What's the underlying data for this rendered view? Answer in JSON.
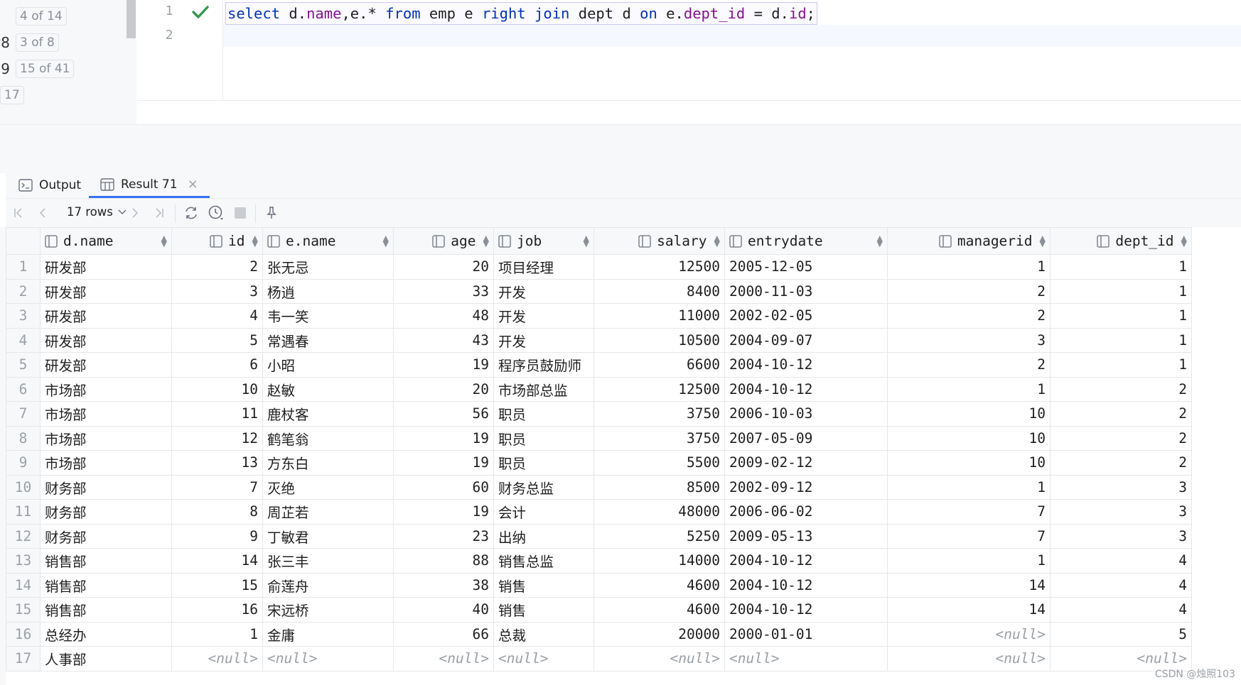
{
  "navigator": {
    "rows": [
      {
        "prefix": "",
        "badge": "4 of 14"
      },
      {
        "prefix": "8",
        "badge": "3 of 8"
      },
      {
        "prefix": "9",
        "badge": "15 of 41"
      },
      {
        "prefix": "",
        "badge": "17"
      }
    ]
  },
  "editor": {
    "line_numbers": [
      "1",
      "2"
    ],
    "tokens": [
      {
        "t": "select",
        "c": "kw"
      },
      {
        "t": " d.",
        "c": "plain"
      },
      {
        "t": "name",
        "c": "fld"
      },
      {
        "t": ",e.* ",
        "c": "plain"
      },
      {
        "t": "from",
        "c": "kw"
      },
      {
        "t": " emp e ",
        "c": "plain"
      },
      {
        "t": "right join",
        "c": "kw"
      },
      {
        "t": " dept d ",
        "c": "plain"
      },
      {
        "t": "on",
        "c": "kw"
      },
      {
        "t": " e.",
        "c": "plain"
      },
      {
        "t": "dept_id",
        "c": "fld"
      },
      {
        "t": " = d.",
        "c": "plain"
      },
      {
        "t": "id",
        "c": "fld"
      },
      {
        "t": ";",
        "c": "plain"
      }
    ]
  },
  "tabs": {
    "output": "Output",
    "result": "Result 71"
  },
  "toolbar": {
    "rows_label": "17 rows"
  },
  "grid": {
    "columns": [
      {
        "name": "d.name",
        "align": "left"
      },
      {
        "name": "id",
        "align": "right"
      },
      {
        "name": "e.name",
        "align": "left"
      },
      {
        "name": "age",
        "align": "right"
      },
      {
        "name": "job",
        "align": "left"
      },
      {
        "name": "salary",
        "align": "right"
      },
      {
        "name": "entrydate",
        "align": "left"
      },
      {
        "name": "managerid",
        "align": "right"
      },
      {
        "name": "dept_id",
        "align": "right"
      }
    ],
    "null_text": "<null>",
    "rows": [
      [
        "研发部",
        "2",
        "张无忌",
        "20",
        "项目经理",
        "12500",
        "2005-12-05",
        "1",
        "1"
      ],
      [
        "研发部",
        "3",
        "杨逍",
        "33",
        "开发",
        "8400",
        "2000-11-03",
        "2",
        "1"
      ],
      [
        "研发部",
        "4",
        "韦一笑",
        "48",
        "开发",
        "11000",
        "2002-02-05",
        "2",
        "1"
      ],
      [
        "研发部",
        "5",
        "常遇春",
        "43",
        "开发",
        "10500",
        "2004-09-07",
        "3",
        "1"
      ],
      [
        "研发部",
        "6",
        "小昭",
        "19",
        "程序员鼓励师",
        "6600",
        "2004-10-12",
        "2",
        "1"
      ],
      [
        "市场部",
        "10",
        "赵敏",
        "20",
        "市场部总监",
        "12500",
        "2004-10-12",
        "1",
        "2"
      ],
      [
        "市场部",
        "11",
        "鹿杖客",
        "56",
        "职员",
        "3750",
        "2006-10-03",
        "10",
        "2"
      ],
      [
        "市场部",
        "12",
        "鹤笔翁",
        "19",
        "职员",
        "3750",
        "2007-05-09",
        "10",
        "2"
      ],
      [
        "市场部",
        "13",
        "方东白",
        "19",
        "职员",
        "5500",
        "2009-02-12",
        "10",
        "2"
      ],
      [
        "财务部",
        "7",
        "灭绝",
        "60",
        "财务总监",
        "8500",
        "2002-09-12",
        "1",
        "3"
      ],
      [
        "财务部",
        "8",
        "周芷若",
        "19",
        "会计",
        "48000",
        "2006-06-02",
        "7",
        "3"
      ],
      [
        "财务部",
        "9",
        "丁敏君",
        "23",
        "出纳",
        "5250",
        "2009-05-13",
        "7",
        "3"
      ],
      [
        "销售部",
        "14",
        "张三丰",
        "88",
        "销售总监",
        "14000",
        "2004-10-12",
        "1",
        "4"
      ],
      [
        "销售部",
        "15",
        "俞莲舟",
        "38",
        "销售",
        "4600",
        "2004-10-12",
        "14",
        "4"
      ],
      [
        "销售部",
        "16",
        "宋远桥",
        "40",
        "销售",
        "4600",
        "2004-10-12",
        "14",
        "4"
      ],
      [
        "总经办",
        "1",
        "金庸",
        "66",
        "总裁",
        "20000",
        "2000-01-01",
        null,
        "5"
      ],
      [
        "人事部",
        null,
        null,
        null,
        null,
        null,
        null,
        null,
        null
      ]
    ]
  },
  "watermark": "CSDN @烛照103"
}
